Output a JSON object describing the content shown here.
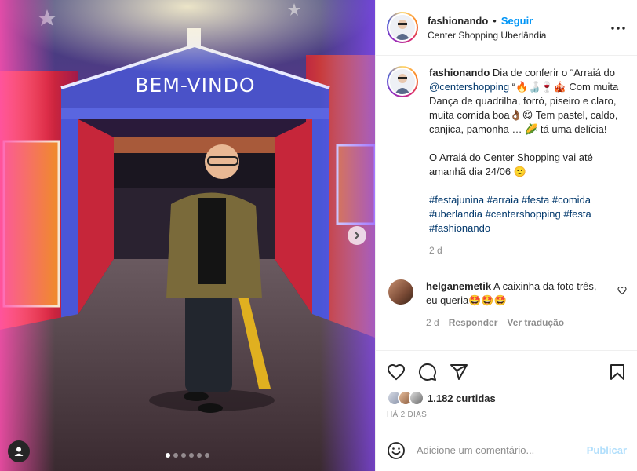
{
  "post": {
    "username": "fashionando",
    "separator": "•",
    "follow_label": "Seguir",
    "location": "Center Shopping Uberlândia",
    "sign_text": "BEM-VINDO"
  },
  "caption": {
    "username": "fashionando",
    "text_1": "Dia de conferir o “Arraiá do ",
    "mention": "@centershopping",
    "text_2": " “🔥🍶🍷🎪 Com muita Dança de quadrilha, forró, piseiro e claro, muita comida boa👌🏾😋 Tem pastel, caldo, canjica, pamonha … 🌽 tá uma delícia!",
    "paragraph_2": "O Arraiá do Center Shopping vai até amanhã dia 24/06 🙂",
    "hashtags": [
      "#festajunina",
      "#arraia",
      "#festa",
      "#comida",
      "#uberlandia",
      "#centershopping",
      "#festa",
      "#fashionando"
    ],
    "age": "2 d"
  },
  "comment": {
    "username": "helganemetik",
    "text": "A caixinha da foto três, eu queria🤩🤩🤩",
    "age": "2 d",
    "reply_label": "Responder",
    "translate_label": "Ver tradução"
  },
  "likes": {
    "count_label": "1.182 curtidas",
    "time_label": "HÁ 2 DIAS"
  },
  "composer": {
    "placeholder": "Adicione um comentário...",
    "publish_label": "Publicar"
  },
  "icons": {
    "like": "heart-icon",
    "comment": "comment-icon",
    "share": "share-icon",
    "save": "bookmark-icon",
    "emoji": "emoji-icon",
    "more": "more-icon",
    "next": "chevron-right-icon",
    "tag": "user-tag-icon"
  },
  "carousel": {
    "count": 6,
    "active_index": 0
  },
  "colors": {
    "accent": "#0095f6",
    "link": "#00376b",
    "muted": "#8e8e8e",
    "publish_disabled": "#b2dffc"
  }
}
